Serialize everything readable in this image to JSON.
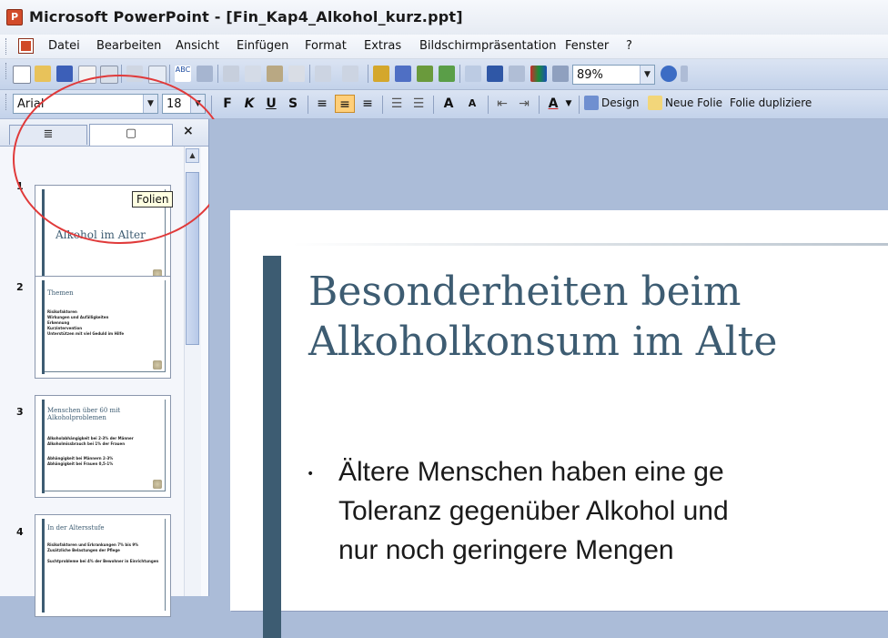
{
  "window": {
    "title": "Microsoft PowerPoint - [Fin_Kap4_Alkohol_kurz.ppt]"
  },
  "menu": {
    "items": [
      "Datei",
      "Bearbeiten",
      "Ansicht",
      "Einfügen",
      "Format",
      "Extras",
      "Bildschirmpräsentation",
      "Fenster",
      "?"
    ]
  },
  "toolbar": {
    "zoom": "89%",
    "font": "Arial",
    "font_size": "18",
    "bold": "F",
    "italic": "K",
    "underline": "U",
    "shadow": "S",
    "increase_font": "A",
    "decrease_font": "A",
    "font_color": "A",
    "design_label": "Design",
    "new_slide_label": "Neue Folie",
    "duplicate_label": "Folie dupliziere"
  },
  "pane": {
    "tab_outline_glyph": "≣",
    "tab_slides_glyph": "▢",
    "close_glyph": "×",
    "tooltip": "Folien"
  },
  "thumbnails": [
    {
      "num": "1",
      "title": "Alkohol im Alter",
      "lines": []
    },
    {
      "num": "2",
      "title": "Themen",
      "lines": [
        "Risikofaktoren",
        "Wirkungen und Aufälligkeiten",
        "Erkennung",
        "Kurzintervention",
        "Unterstützen mit viel Geduld im Hilfe"
      ]
    },
    {
      "num": "3",
      "title": "Menschen über 60 mit Alkoholproblemen",
      "lines": [
        "Alkoholabhängigkeit bei 2-3% der Männer",
        "Alkoholmissbrauch bei 1% der Frauen",
        "Abhängigkeit bei Männern 2-3%",
        "Abhängigkeit bei Frauen 0,5-1%"
      ]
    },
    {
      "num": "4",
      "title": "In der Altersstufe",
      "lines": [
        "Risikofaktoren und Erkrankungen 7% bis 9%",
        "Zusätzliche Belastungen der Pflege",
        "Suchtprobleme bei 4% der Bewohner in Einrichtungen"
      ]
    }
  ],
  "slide": {
    "heading": "Besonderheiten beim\nAlkoholkonsum im Alte",
    "bullet_glyph": "•",
    "body": "Ältere Menschen haben eine ge\nToleranz gegenüber Alkohol und\nnur noch geringere Mengen"
  },
  "colors": {
    "accent": "#3d5c72",
    "annotation": "#e03a3a"
  }
}
